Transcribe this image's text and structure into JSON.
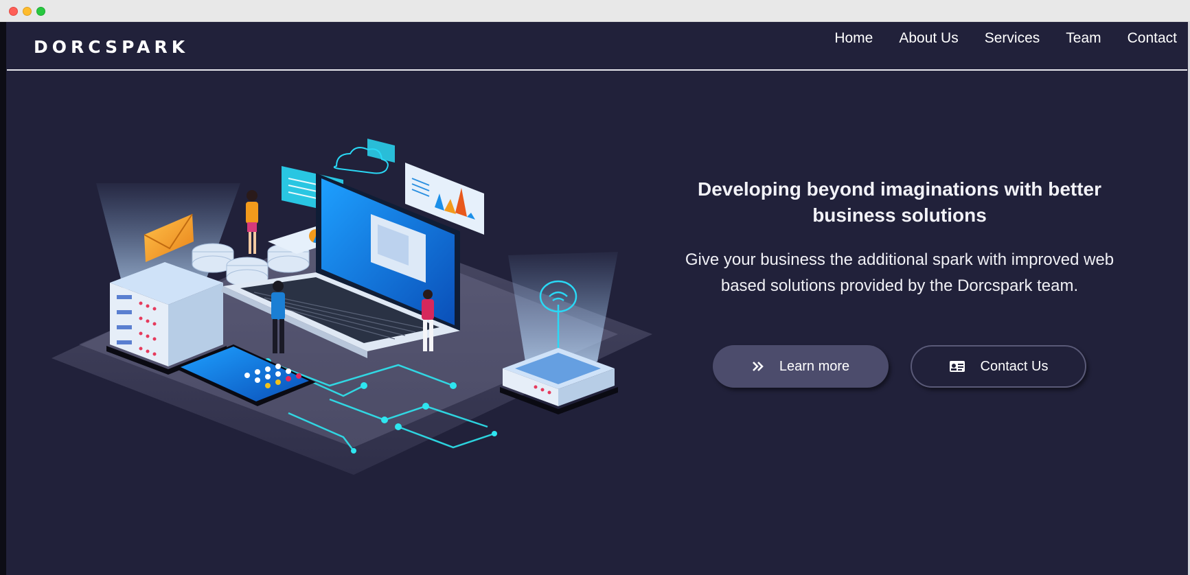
{
  "brand": {
    "name": "DORCSPARK"
  },
  "nav": {
    "items": [
      {
        "label": "Home"
      },
      {
        "label": "About Us"
      },
      {
        "label": "Services"
      },
      {
        "label": "Team"
      },
      {
        "label": "Contact"
      }
    ]
  },
  "hero": {
    "title": "Developing beyond imaginations with better business solutions",
    "subtitle": "Give your business the additional spark with improved web based solutions provided by the Dorcspark team.",
    "learn_more_label": "Learn more",
    "contact_label": "Contact Us"
  },
  "icons": {
    "learn_more": "double-chevron-right-icon",
    "contact": "contact-card-icon"
  },
  "colors": {
    "background": "#21213a",
    "primary_button": "#4c4c6c",
    "accent_cyan": "#29d6f0",
    "accent_blue": "#1976e0"
  }
}
